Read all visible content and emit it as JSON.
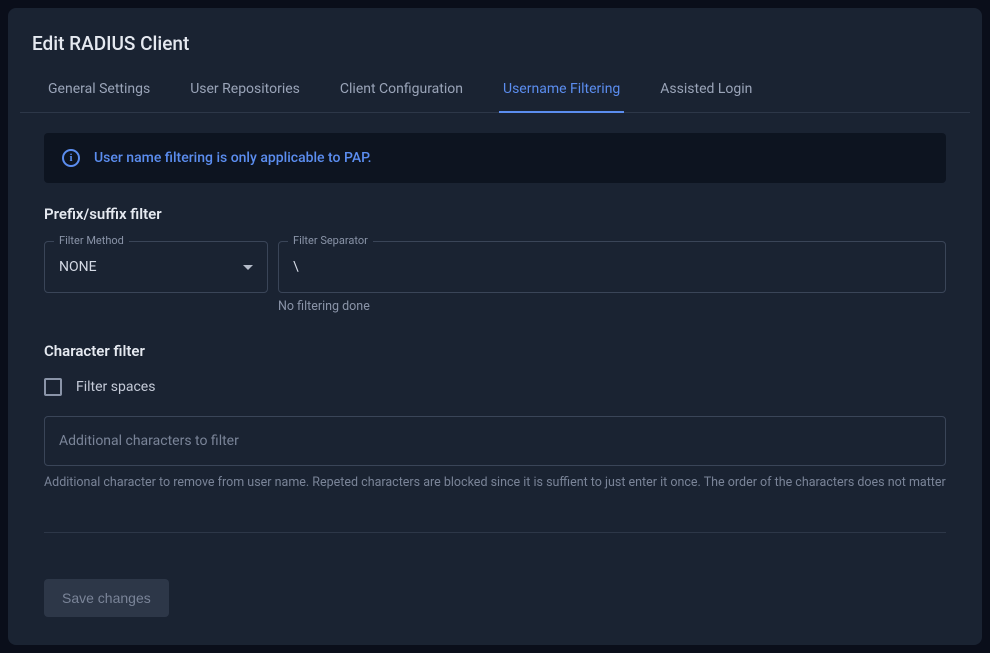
{
  "header": {
    "title": "Edit RADIUS Client"
  },
  "tabs": [
    {
      "label": "General Settings",
      "active": false
    },
    {
      "label": "User Repositories",
      "active": false
    },
    {
      "label": "Client Configuration",
      "active": false
    },
    {
      "label": "Username Filtering",
      "active": true
    },
    {
      "label": "Assisted Login",
      "active": false
    }
  ],
  "banner": {
    "text": "User name filtering is only applicable to PAP."
  },
  "prefix_suffix": {
    "heading": "Prefix/suffix filter",
    "method_label": "Filter Method",
    "method_value": "NONE",
    "separator_label": "Filter Separator",
    "separator_value": "\\",
    "helper": "No filtering done"
  },
  "character_filter": {
    "heading": "Character filter",
    "checkbox_label": "Filter spaces",
    "input_placeholder": "Additional characters to filter",
    "helper": "Additional character to remove from user name. Repeted characters are blocked since it is suffient to just enter it once. The order of the characters does not matter"
  },
  "footer": {
    "save_label": "Save changes"
  }
}
